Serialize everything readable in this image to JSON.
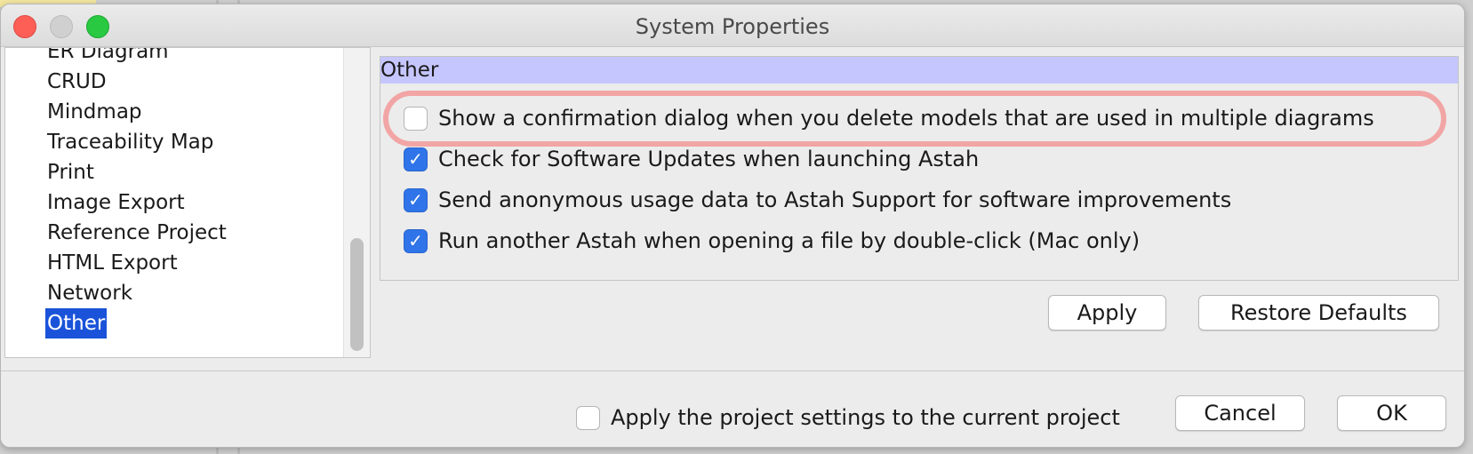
{
  "window": {
    "title": "System Properties"
  },
  "tree": {
    "items": [
      {
        "label": "ER Diagram"
      },
      {
        "label": "CRUD"
      },
      {
        "label": "Mindmap"
      },
      {
        "label": "Traceability Map"
      },
      {
        "label": "Print"
      },
      {
        "label": "Image Export"
      },
      {
        "label": "Reference Project"
      },
      {
        "label": "HTML Export"
      },
      {
        "label": "Network"
      },
      {
        "label": "Other",
        "selected": true
      }
    ]
  },
  "panel": {
    "header": "Other",
    "options": [
      {
        "label": "Show a confirmation dialog when you delete models that are used in multiple diagrams",
        "checked": false
      },
      {
        "label": "Check for Software Updates when launching Astah",
        "checked": true
      },
      {
        "label": "Send anonymous usage data to Astah Support for software improvements",
        "checked": true
      },
      {
        "label": "Run another Astah when opening a file by double-click (Mac only)",
        "checked": true
      }
    ]
  },
  "buttons": {
    "apply": "Apply",
    "restore_defaults": "Restore Defaults",
    "cancel": "Cancel",
    "ok": "OK"
  },
  "footer": {
    "project_settings_label": "Apply the project settings to the current project",
    "project_settings_checked": false
  },
  "icons": {
    "check": "checkmark-icon"
  },
  "colors": {
    "selection": "#1a53d9",
    "panel_header": "#c6c6ff",
    "checkbox_checked": "#2f74e8",
    "highlight": "#f2a5a5"
  }
}
